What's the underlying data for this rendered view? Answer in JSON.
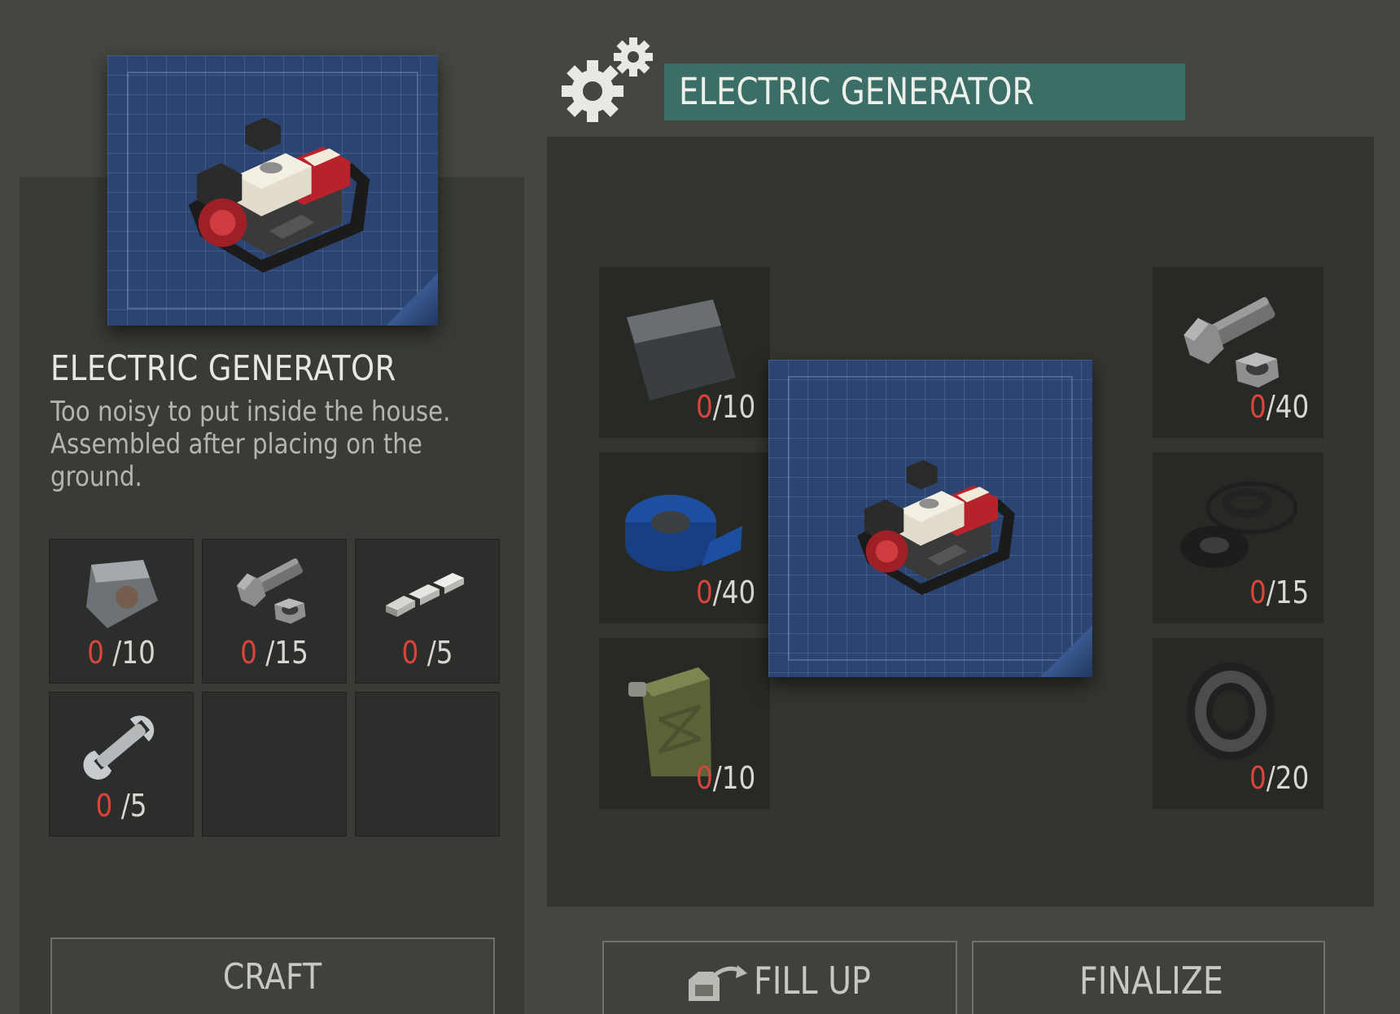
{
  "left_panel": {
    "item_title": "ELECTRIC GENERATOR",
    "item_description": "Too noisy to put inside the house. Assembled after placing on the ground.",
    "requirements": [
      {
        "icon": "metal-plate-icon",
        "have": "0",
        "need": " /10"
      },
      {
        "icon": "bolt-nut-icon",
        "have": "0",
        "need": " /15"
      },
      {
        "icon": "metal-ingots-icon",
        "have": "0",
        "need": " /5"
      },
      {
        "icon": "wrench-icon",
        "have": "0",
        "need": " /5"
      }
    ],
    "craft_label": "CRAFT"
  },
  "right_panel": {
    "title": "ELECTRIC GENERATOR",
    "ingredients_left": [
      {
        "icon": "metal-sheet-icon",
        "have": "0",
        "need": "/10"
      },
      {
        "icon": "duct-tape-icon",
        "have": "0",
        "need": "/40"
      },
      {
        "icon": "jerrycan-icon",
        "have": "0",
        "need": "/10"
      }
    ],
    "ingredients_right": [
      {
        "icon": "bolt-nut-icon",
        "have": "0",
        "need": "/40"
      },
      {
        "icon": "rubber-seals-icon",
        "have": "0",
        "need": "/15"
      },
      {
        "icon": "bearing-icon",
        "have": "0",
        "need": "/20"
      }
    ],
    "fill_up_label": "FILL UP",
    "finalize_label": "FINALIZE"
  },
  "colors": {
    "title_bar": "#3a6e67",
    "missing_count": "#d9443c",
    "blueprint": "#2c4472"
  }
}
